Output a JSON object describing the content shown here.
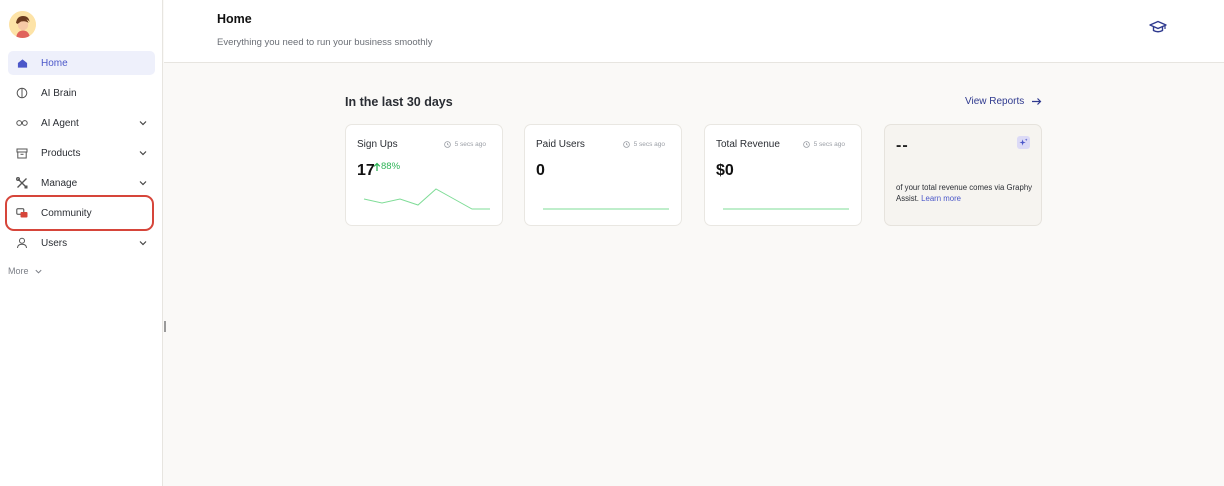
{
  "sidebar": {
    "items": [
      {
        "label": "Home",
        "icon": "home-icon",
        "active": true,
        "chevron": false
      },
      {
        "label": "AI Brain",
        "icon": "brain-icon",
        "active": false,
        "chevron": false
      },
      {
        "label": "AI Agent",
        "icon": "infinity-icon",
        "active": false,
        "chevron": true
      },
      {
        "label": "Products",
        "icon": "archive-box-icon",
        "active": false,
        "chevron": true
      },
      {
        "label": "Manage",
        "icon": "tools-icon",
        "active": false,
        "chevron": true
      },
      {
        "label": "Community",
        "icon": "chat-bubbles-icon",
        "active": false,
        "chevron": false
      },
      {
        "label": "Users",
        "icon": "user-icon",
        "active": false,
        "chevron": true
      }
    ],
    "more_label": "More",
    "highlighted_item": "Community"
  },
  "header": {
    "title": "Home",
    "subtitle": "Everything you need to run your business smoothly",
    "right_icon": "graduation-cap-icon"
  },
  "main": {
    "section_title": "In the last 30 days",
    "view_reports_label": "View Reports",
    "cards": [
      {
        "title": "Sign Ups",
        "updated": "5 secs ago",
        "value": "17",
        "delta": "88%",
        "delta_direction": "up",
        "sparkline": [
          5,
          3,
          5,
          2,
          10,
          5,
          0,
          0
        ]
      },
      {
        "title": "Paid Users",
        "updated": "5 secs ago",
        "value": "0",
        "sparkline": [
          0,
          0
        ]
      },
      {
        "title": "Total Revenue",
        "updated": "5 secs ago",
        "value": "$0",
        "sparkline": [
          0,
          0
        ]
      }
    ],
    "assist_card": {
      "value": "--",
      "text": "of your total revenue comes via Graphy Assist. Learn more",
      "link": "Learn more"
    }
  },
  "colors": {
    "accent": "#4b57c9",
    "positive": "#2fb457",
    "highlight_border": "#d6453a",
    "background": "#faf9f7"
  }
}
